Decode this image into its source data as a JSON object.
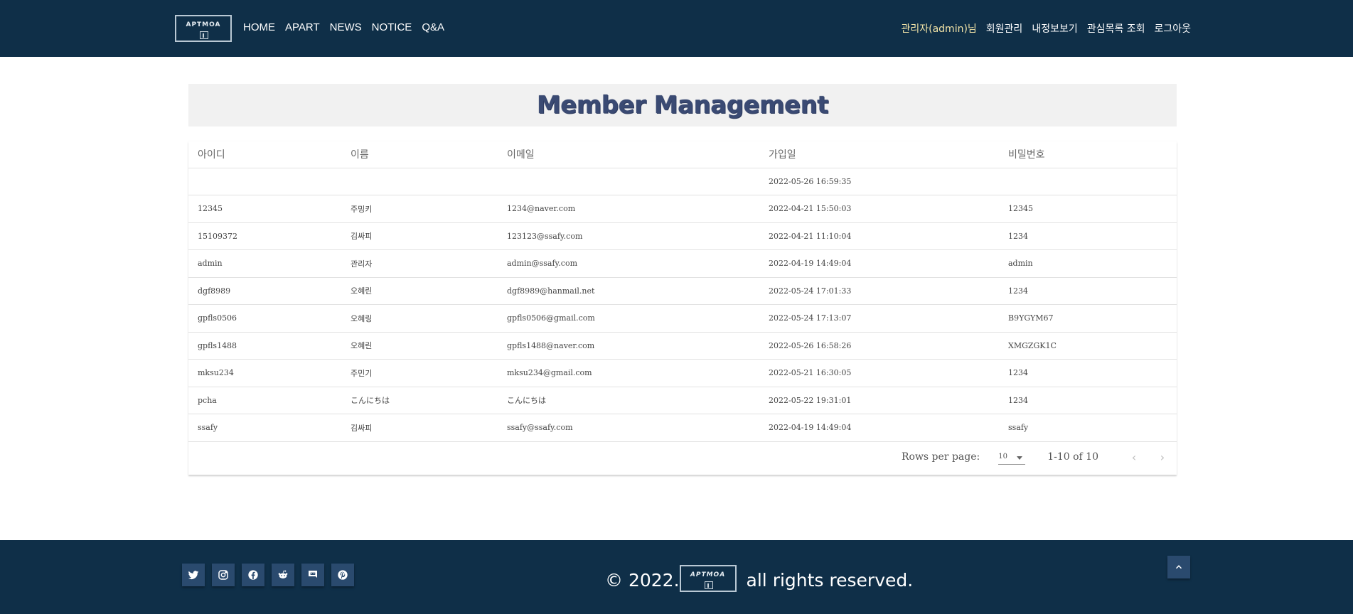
{
  "header": {
    "logo_text": "APTMOA",
    "nav_left": [
      "HOME",
      "APART",
      "NEWS",
      "NOTICE",
      "Q&A"
    ],
    "user_label": "관리자(admin)님",
    "nav_right": [
      "회원관리",
      "내정보보기",
      "관심목록 조회",
      "로그아웃"
    ]
  },
  "page_title": "Member Management",
  "table": {
    "columns": [
      "아이디",
      "이름",
      "이메일",
      "가입일",
      "비밀번호"
    ],
    "rows": [
      [
        "",
        "",
        "",
        "2022-05-26 16:59:35",
        ""
      ],
      [
        "12345",
        "주밍키",
        "1234@naver.com",
        "2022-04-21 15:50:03",
        "12345"
      ],
      [
        "15109372",
        "김싸피",
        "123123@ssafy.com",
        "2022-04-21 11:10:04",
        "1234"
      ],
      [
        "admin",
        "관리자",
        "admin@ssafy.com",
        "2022-04-19 14:49:04",
        "admin"
      ],
      [
        "dgf8989",
        "오혜린",
        "dgf8989@hanmail.net",
        "2022-05-24 17:01:33",
        "1234"
      ],
      [
        "gpfls0506",
        "오혜링",
        "gpfls0506@gmail.com",
        "2022-05-24 17:13:07",
        "B9YGYM67"
      ],
      [
        "gpfls1488",
        "오혜린",
        "gpfls1488@naver.com",
        "2022-05-26 16:58:26",
        "XMGZGK1C"
      ],
      [
        "mksu234",
        "주민기",
        "mksu234@gmail.com",
        "2022-05-21 16:30:05",
        "1234"
      ],
      [
        "pcha",
        "こんにちは",
        "こんにちは",
        "2022-05-22 19:31:01",
        "1234"
      ],
      [
        "ssafy",
        "김싸피",
        "ssafy@ssafy.com",
        "2022-04-19 14:49:04",
        "ssafy"
      ]
    ]
  },
  "pagination": {
    "rows_per_page_label": "Rows per page:",
    "rows_per_page_value": "10",
    "range_text": "1-10 of 10",
    "prev_icon": "chevron-left-icon",
    "next_icon": "chevron-right-icon"
  },
  "footer": {
    "social_icons": [
      "twitter-icon",
      "instagram-icon",
      "facebook-icon",
      "reddit-icon",
      "discord-icon",
      "pinterest-icon"
    ],
    "copyright_prefix": "© 2022.",
    "logo_text": "APTMOA",
    "copyright_suffix": "all rights reserved.",
    "scroll_top_icon": "chevron-up-icon"
  },
  "colors": {
    "header_bg": "#0f2f48",
    "title_color": "#3a4a73",
    "user_label_color": "#f5e6a8"
  }
}
